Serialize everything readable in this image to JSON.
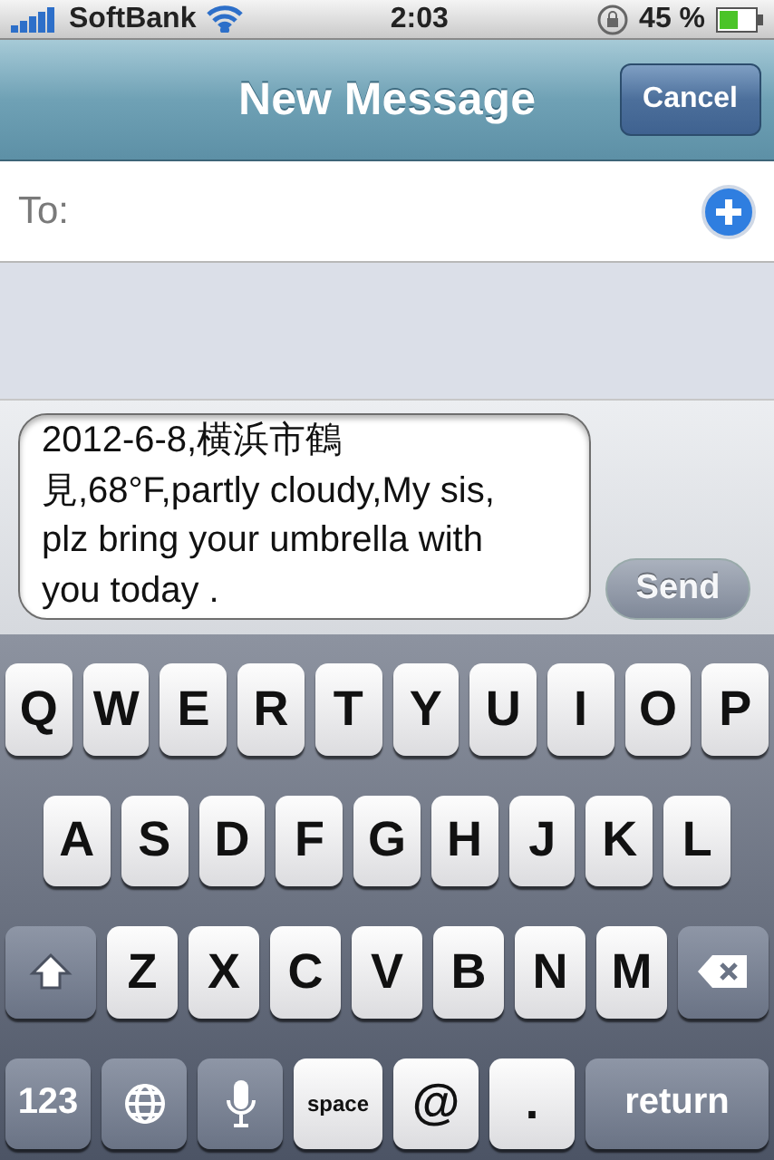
{
  "status_bar": {
    "carrier": "SoftBank",
    "time": "2:03",
    "battery": "45 %"
  },
  "nav_bar": {
    "title": "New Message",
    "cancel": "Cancel"
  },
  "to_field": {
    "label": "To:"
  },
  "compose": {
    "value": "2012-6-8,横浜市鶴見,68°F,partly cloudy,My sis, plz bring your umbrella with you today .",
    "send": {
      "label": "Send",
      "disabled": true
    }
  },
  "keyboard": {
    "rows": [
      {
        "keys": [
          {
            "kind": "letter",
            "label": "Q"
          },
          {
            "kind": "letter",
            "label": "W"
          },
          {
            "kind": "letter",
            "label": "E"
          },
          {
            "kind": "letter",
            "label": "R"
          },
          {
            "kind": "letter",
            "label": "T"
          },
          {
            "kind": "letter",
            "label": "Y"
          },
          {
            "kind": "letter",
            "label": "U"
          },
          {
            "kind": "letter",
            "label": "I"
          },
          {
            "kind": "letter",
            "label": "O"
          },
          {
            "kind": "letter",
            "label": "P"
          }
        ]
      },
      {
        "keys": [
          {
            "kind": "letter",
            "label": "A"
          },
          {
            "kind": "letter",
            "label": "S"
          },
          {
            "kind": "letter",
            "label": "D"
          },
          {
            "kind": "letter",
            "label": "F"
          },
          {
            "kind": "letter",
            "label": "G"
          },
          {
            "kind": "letter",
            "label": "H"
          },
          {
            "kind": "letter",
            "label": "J"
          },
          {
            "kind": "letter",
            "label": "K"
          },
          {
            "kind": "letter",
            "label": "L"
          }
        ]
      },
      {
        "keys": [
          {
            "kind": "shift"
          },
          {
            "kind": "letter",
            "label": "Z"
          },
          {
            "kind": "letter",
            "label": "X"
          },
          {
            "kind": "letter",
            "label": "C"
          },
          {
            "kind": "letter",
            "label": "V"
          },
          {
            "kind": "letter",
            "label": "B"
          },
          {
            "kind": "letter",
            "label": "N"
          },
          {
            "kind": "letter",
            "label": "M"
          },
          {
            "kind": "delete"
          }
        ]
      },
      {
        "keys": [
          {
            "kind": "mode",
            "label": "123"
          },
          {
            "kind": "globe"
          },
          {
            "kind": "mic"
          },
          {
            "kind": "space",
            "label": "space"
          },
          {
            "kind": "symbol",
            "label": "@"
          },
          {
            "kind": "symbol",
            "label": "."
          },
          {
            "kind": "return",
            "label": "return"
          }
        ]
      }
    ]
  }
}
